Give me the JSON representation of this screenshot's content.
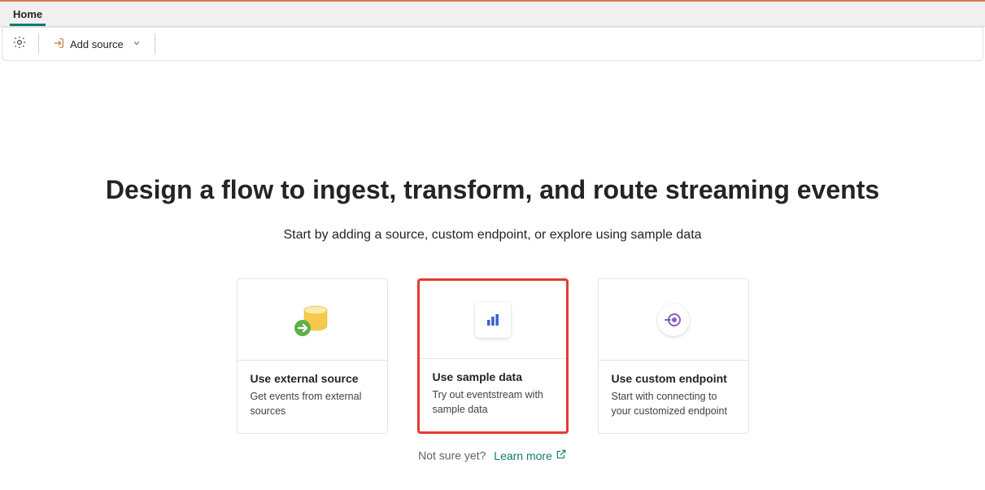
{
  "tabs": {
    "home": "Home"
  },
  "toolbar": {
    "add_source": "Add source"
  },
  "main": {
    "headline": "Design a flow to ingest, transform, and route streaming events",
    "subhead": "Start by adding a source, custom endpoint, or explore using sample data",
    "cards": [
      {
        "title": "Use external source",
        "desc": "Get events from external sources"
      },
      {
        "title": "Use sample data",
        "desc": "Try out eventstream with sample data"
      },
      {
        "title": "Use custom endpoint",
        "desc": "Start with connecting to your customized endpoint"
      }
    ],
    "footer_prompt": "Not sure yet?",
    "learn_more": "Learn more"
  }
}
